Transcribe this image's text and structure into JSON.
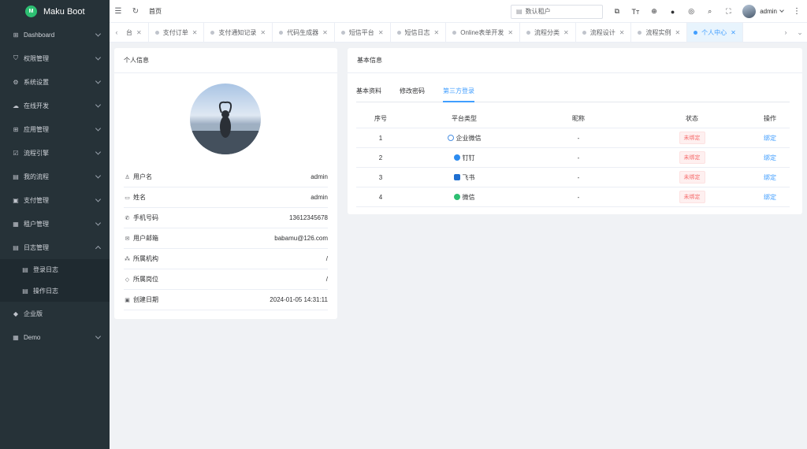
{
  "app": {
    "title": "Maku Boot",
    "logo_text": "M"
  },
  "sidebar": {
    "items": [
      {
        "label": "Dashboard",
        "icon": "dashboard-icon",
        "expanded": false
      },
      {
        "label": "权限管理",
        "icon": "shield-icon",
        "expanded": false
      },
      {
        "label": "系统设置",
        "icon": "gear-icon",
        "expanded": false
      },
      {
        "label": "在线开发",
        "icon": "cloud-icon",
        "expanded": false
      },
      {
        "label": "应用管理",
        "icon": "apps-icon",
        "expanded": false
      },
      {
        "label": "流程引擎",
        "icon": "flow-icon",
        "expanded": false
      },
      {
        "label": "我的流程",
        "icon": "document-icon",
        "expanded": false
      },
      {
        "label": "支付管理",
        "icon": "payment-icon",
        "expanded": false
      },
      {
        "label": "租户管理",
        "icon": "tenant-icon",
        "expanded": false
      },
      {
        "label": "日志管理",
        "icon": "log-icon",
        "expanded": true,
        "children": [
          {
            "label": "登录日志",
            "icon": "login-log-icon"
          },
          {
            "label": "操作日志",
            "icon": "operation-log-icon"
          }
        ]
      },
      {
        "label": "企业版",
        "icon": "diamond-icon",
        "expanded": false
      },
      {
        "label": "Demo",
        "icon": "demo-icon",
        "expanded": false
      }
    ]
  },
  "topbar": {
    "home_label": "首页",
    "tenant_placeholder": "数认租户",
    "user_name": "admin"
  },
  "tabs": [
    {
      "label": "台",
      "active": false
    },
    {
      "label": "支付订单",
      "active": false
    },
    {
      "label": "支付通知记录",
      "active": false
    },
    {
      "label": "代码生成器",
      "active": false
    },
    {
      "label": "短信平台",
      "active": false
    },
    {
      "label": "短信日志",
      "active": false
    },
    {
      "label": "Online表单开发",
      "active": false
    },
    {
      "label": "流程分类",
      "active": false
    },
    {
      "label": "流程设计",
      "active": false
    },
    {
      "label": "流程实例",
      "active": false
    },
    {
      "label": "个人中心",
      "active": true
    }
  ],
  "profile": {
    "header": "个人信息",
    "rows": [
      {
        "label": "用户名",
        "value": "admin",
        "icon": "user-icon"
      },
      {
        "label": "姓名",
        "value": "admin",
        "icon": "id-card-icon"
      },
      {
        "label": "手机号码",
        "value": "13612345678",
        "icon": "phone-icon"
      },
      {
        "label": "用户邮箱",
        "value": "babamu@126.com",
        "icon": "mail-icon"
      },
      {
        "label": "所属机构",
        "value": "/",
        "icon": "org-icon"
      },
      {
        "label": "所属岗位",
        "value": "/",
        "icon": "tag-icon"
      },
      {
        "label": "创建日期",
        "value": "2024-01-05 14:31:11",
        "icon": "calendar-icon"
      }
    ]
  },
  "basic": {
    "header": "基本信息",
    "tabs": [
      {
        "label": "基本资料",
        "active": false
      },
      {
        "label": "修改密码",
        "active": false
      },
      {
        "label": "第三方登录",
        "active": true
      }
    ],
    "table": {
      "headers": [
        "序号",
        "平台类型",
        "昵称",
        "状态",
        "操作"
      ],
      "rows": [
        {
          "index": "1",
          "platform": "企业微信",
          "icon": "wecom-icon",
          "color": "#4a90e2",
          "nickname": "-",
          "status": "未绑定",
          "action": "绑定"
        },
        {
          "index": "2",
          "platform": "钉钉",
          "icon": "dingtalk-icon",
          "color": "#2d8cf0",
          "nickname": "-",
          "status": "未绑定",
          "action": "绑定"
        },
        {
          "index": "3",
          "platform": "飞书",
          "icon": "feishu-icon",
          "color": "#1f6fd1",
          "nickname": "-",
          "status": "未绑定",
          "action": "绑定"
        },
        {
          "index": "4",
          "platform": "微信",
          "icon": "wechat-icon",
          "color": "#2dbf72",
          "nickname": "-",
          "status": "未绑定",
          "action": "绑定"
        }
      ]
    }
  },
  "colors": {
    "sidebar_bg": "#263238",
    "accent": "#409eff",
    "danger": "#f56c6c"
  }
}
